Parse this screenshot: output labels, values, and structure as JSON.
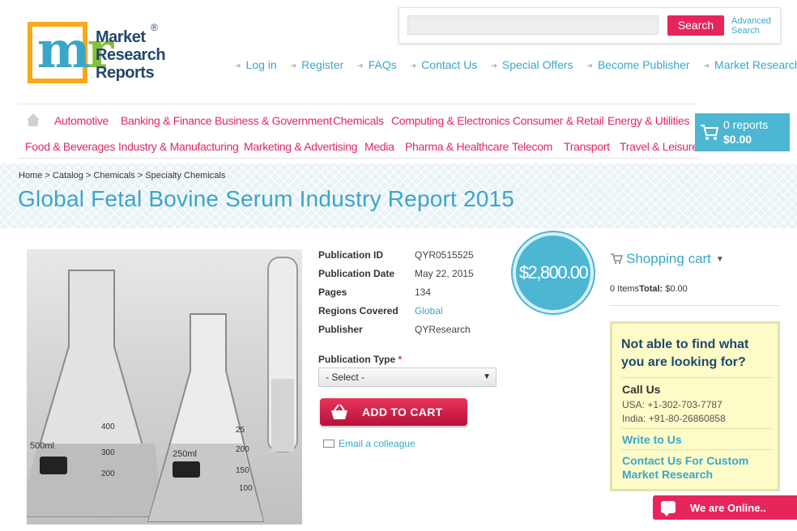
{
  "header": {
    "logo_text": [
      "Market",
      "Research",
      "Reports"
    ],
    "logo_reg": "®",
    "search": {
      "placeholder": "",
      "button": "Search",
      "advanced_line1": "Advanced",
      "advanced_line2": "Search"
    },
    "top_links": [
      "Log in",
      "Register",
      "FAQs",
      "Contact Us",
      "Special Offers",
      "Become Publisher",
      "Market Research Blog"
    ]
  },
  "nav": {
    "row1": [
      "Automotive",
      "Banking & Finance",
      "Business & Government",
      "Chemicals",
      "Computing & Electronics",
      "Consumer & Retail",
      "Energy & Utilities"
    ],
    "row2": [
      "Food & Beverages",
      "Industry & Manufacturing",
      "Marketing & Advertising",
      "Media",
      "Pharma & Healthcare",
      "Telecom",
      "Transport",
      "Travel & Leisure"
    ]
  },
  "cart": {
    "count": "0 reports",
    "total": "$0.00"
  },
  "breadcrumb": [
    "Home",
    "Catalog",
    "Chemicals",
    "Specialty Chemicals"
  ],
  "breadcrumb_sep": ">",
  "title": "Global Fetal Bovine Serum Industry Report 2015",
  "product": {
    "details": [
      {
        "label": "Publication ID",
        "value": "QYR0515525",
        "link": false
      },
      {
        "label": "Publication Date",
        "value": "May 22, 2015",
        "link": false
      },
      {
        "label": "Pages",
        "value": "134",
        "link": false
      },
      {
        "label": "Regions Covered",
        "value": "Global",
        "link": true
      },
      {
        "label": "Publisher",
        "value": "QYResearch",
        "link": false
      }
    ],
    "price": "$2,800.00",
    "pub_type_label": "Publication Type",
    "required_mark": "*",
    "pub_type_selected": "- Select -",
    "add_to_cart": "ADD TO CART",
    "email_colleague": "Email a colleague",
    "flask_labels": [
      "500ml",
      "400",
      "300",
      "200",
      "250ml",
      "200",
      "150",
      "100",
      "25"
    ]
  },
  "sidebar": {
    "shopping_cart_title": "Shopping cart",
    "items_text": "0 Items",
    "total_label": "Total:",
    "total_value": "$0.00",
    "help_question": "Not able to find what you are looking for?",
    "call_us": "Call Us",
    "phone_usa": "USA: +1-302-703-7787",
    "phone_india": "India: +91-80-26860858",
    "write_to_us": "Write to Us",
    "contact_custom": "Contact Us For Custom Market Research"
  },
  "chat": {
    "label": "We are Online.."
  },
  "colors": {
    "accent_pink": "#e6265b",
    "accent_blue": "#3aa6c9",
    "cart_blue": "#4cb6d3",
    "logo_orange": "#f7a81b"
  }
}
